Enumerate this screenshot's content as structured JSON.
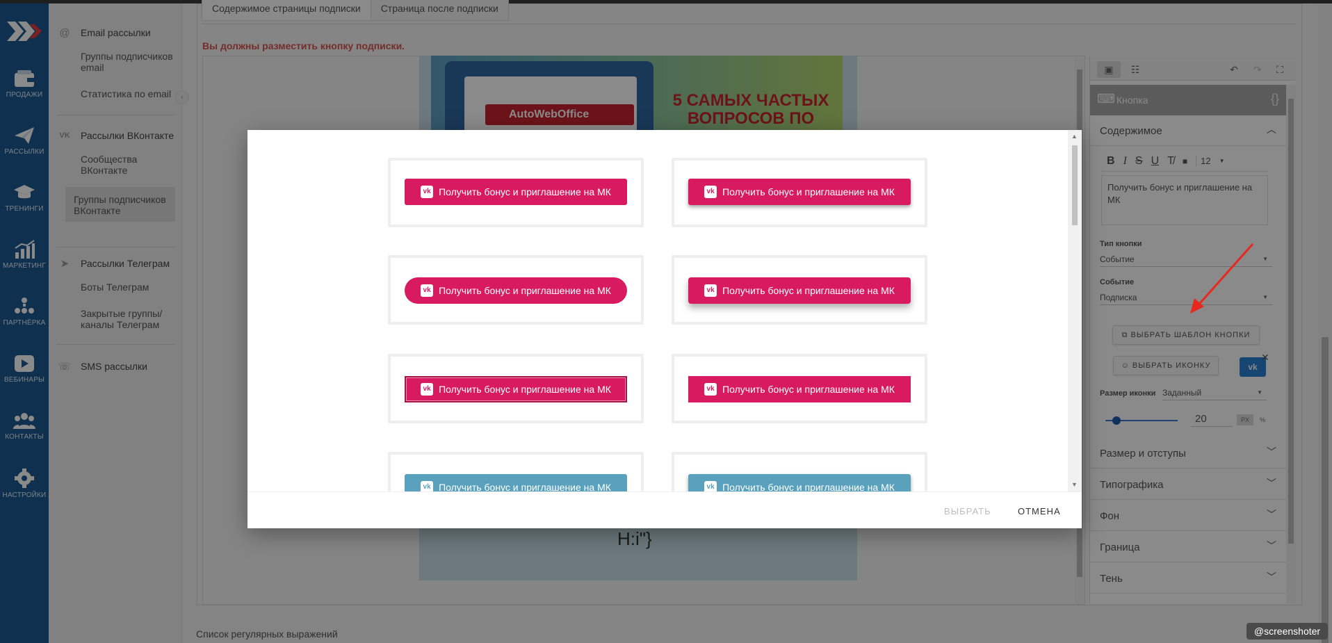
{
  "nav": {
    "items": [
      {
        "label": "ПРОДАЖИ",
        "icon": "wallet-icon"
      },
      {
        "label": "РАССЫЛКИ",
        "icon": "paper-plane-icon"
      },
      {
        "label": "ТРЕНИНГИ",
        "icon": "graduation-cap-icon"
      },
      {
        "label": "МАРКЕТИНГ",
        "icon": "chart-growth-icon"
      },
      {
        "label": "ПАРТНЁРКА",
        "icon": "people-network-icon"
      },
      {
        "label": "ВЕБИНАРЫ",
        "icon": "play-icon"
      },
      {
        "label": "КОНТАКТЫ",
        "icon": "users-icon"
      },
      {
        "label": "НАСТРОЙКИ",
        "icon": "gear-icon"
      }
    ]
  },
  "subnav": {
    "email": {
      "title": "Email рассылки",
      "items": [
        "Группы подписчиков email",
        "Статистика по email"
      ]
    },
    "vk": {
      "title": "Рассылки ВКонтакте",
      "items": [
        "Сообщества ВКонтакте",
        "Группы подписчиков ВКонтакте"
      ]
    },
    "telegram": {
      "title": "Рассылки Телеграм",
      "items": [
        "Боты Телеграм",
        "Закрытые группы/ каналы Телеграм"
      ]
    },
    "sms": {
      "title": "SMS рассылки"
    }
  },
  "main": {
    "tabs": [
      "Содержимое страницы подписки",
      "Страница после подписки"
    ],
    "warning": "Вы должны разместить кнопку подписки.",
    "banner": {
      "brand": "AutoWebOffice",
      "headline": "5 САМЫХ ЧАСТЫХ ВОПРОСОВ ПО"
    },
    "canvas_text": "H:i\"}",
    "footer_link": "Список регулярных выражений"
  },
  "right_panel": {
    "element_title": "Кнопка",
    "braces": "{}",
    "content_section": "Содержимое",
    "font_size": "12",
    "text": "Получить бонус и приглашение на МК",
    "button_type_label": "Тип кнопки",
    "button_type_value": "Событие",
    "event_label": "Событие",
    "event_value": "Подписка",
    "choose_template": "ВЫБРАТЬ ШАБЛОН КНОПКИ",
    "choose_icon": "ВЫБРАТЬ ИКОНКУ",
    "icon_size_label": "Размер иконки",
    "icon_size_value": "Заданный",
    "icon_size_number": "20",
    "unit_px": "PX",
    "unit_pct": "%",
    "sections": [
      "Размер и отступы",
      "Типографика",
      "Фон",
      "Граница",
      "Тень"
    ]
  },
  "modal": {
    "button_label": "Получить бонус и приглашение на МК",
    "vk_glyph": "vk",
    "select": "ВЫБРАТЬ",
    "cancel": "ОТМЕНА"
  },
  "colors": {
    "primary_pink": "#d81b60",
    "teal": "#5aa1bd",
    "nav_blue": "#1d5a93"
  },
  "watermark": "@screenshoter"
}
